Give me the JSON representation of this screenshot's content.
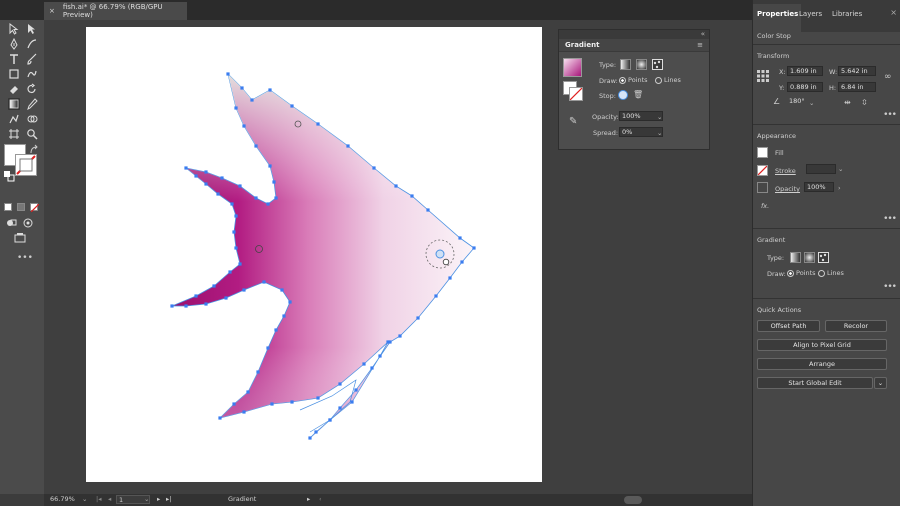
{
  "document": {
    "tab_title": "fish.ai* @ 66.79% (RGB/GPU Preview)",
    "close_glyph": "×"
  },
  "gradient_panel": {
    "title": "Gradient",
    "type_label": "Type:",
    "draw_label": "Draw:",
    "draw_points": "Points",
    "draw_lines": "Lines",
    "stop_label": "Stop:",
    "opacity_label": "Opacity:",
    "opacity_value": "100%",
    "spread_label": "Spread:",
    "spread_value": "0%"
  },
  "properties": {
    "tabs": [
      "Properties",
      "Layers",
      "Libraries"
    ],
    "context": "Color Stop",
    "transform": {
      "title": "Transform",
      "x_label": "X:",
      "x": "1.609 in",
      "y_label": "Y:",
      "y": "0.889 in",
      "w_label": "W:",
      "w": "5.642 in",
      "h_label": "H:",
      "h": "6.84 in",
      "angle": "180°"
    },
    "appearance": {
      "title": "Appearance",
      "fill": "Fill",
      "stroke": "Stroke",
      "opacity_label": "Opacity",
      "opacity_value": "100%",
      "fx": "fx."
    },
    "gradient": {
      "title": "Gradient",
      "type_label": "Type:",
      "draw_label": "Draw:",
      "points": "Points",
      "lines": "Lines"
    },
    "quick_actions": {
      "title": "Quick Actions",
      "offset_path": "Offset Path",
      "recolor": "Recolor",
      "align_pixel": "Align to Pixel Grid",
      "arrange": "Arrange",
      "global_edit": "Start Global Edit"
    }
  },
  "status": {
    "zoom": "66.79%",
    "page": "1",
    "tool": "Gradient"
  },
  "colors": {
    "gradient_dark": "#a8157a",
    "gradient_light": "#f3e6f0",
    "tail_dark": "#a0106e",
    "anchor": "#3a7df0",
    "selection": "#4a90e2"
  }
}
